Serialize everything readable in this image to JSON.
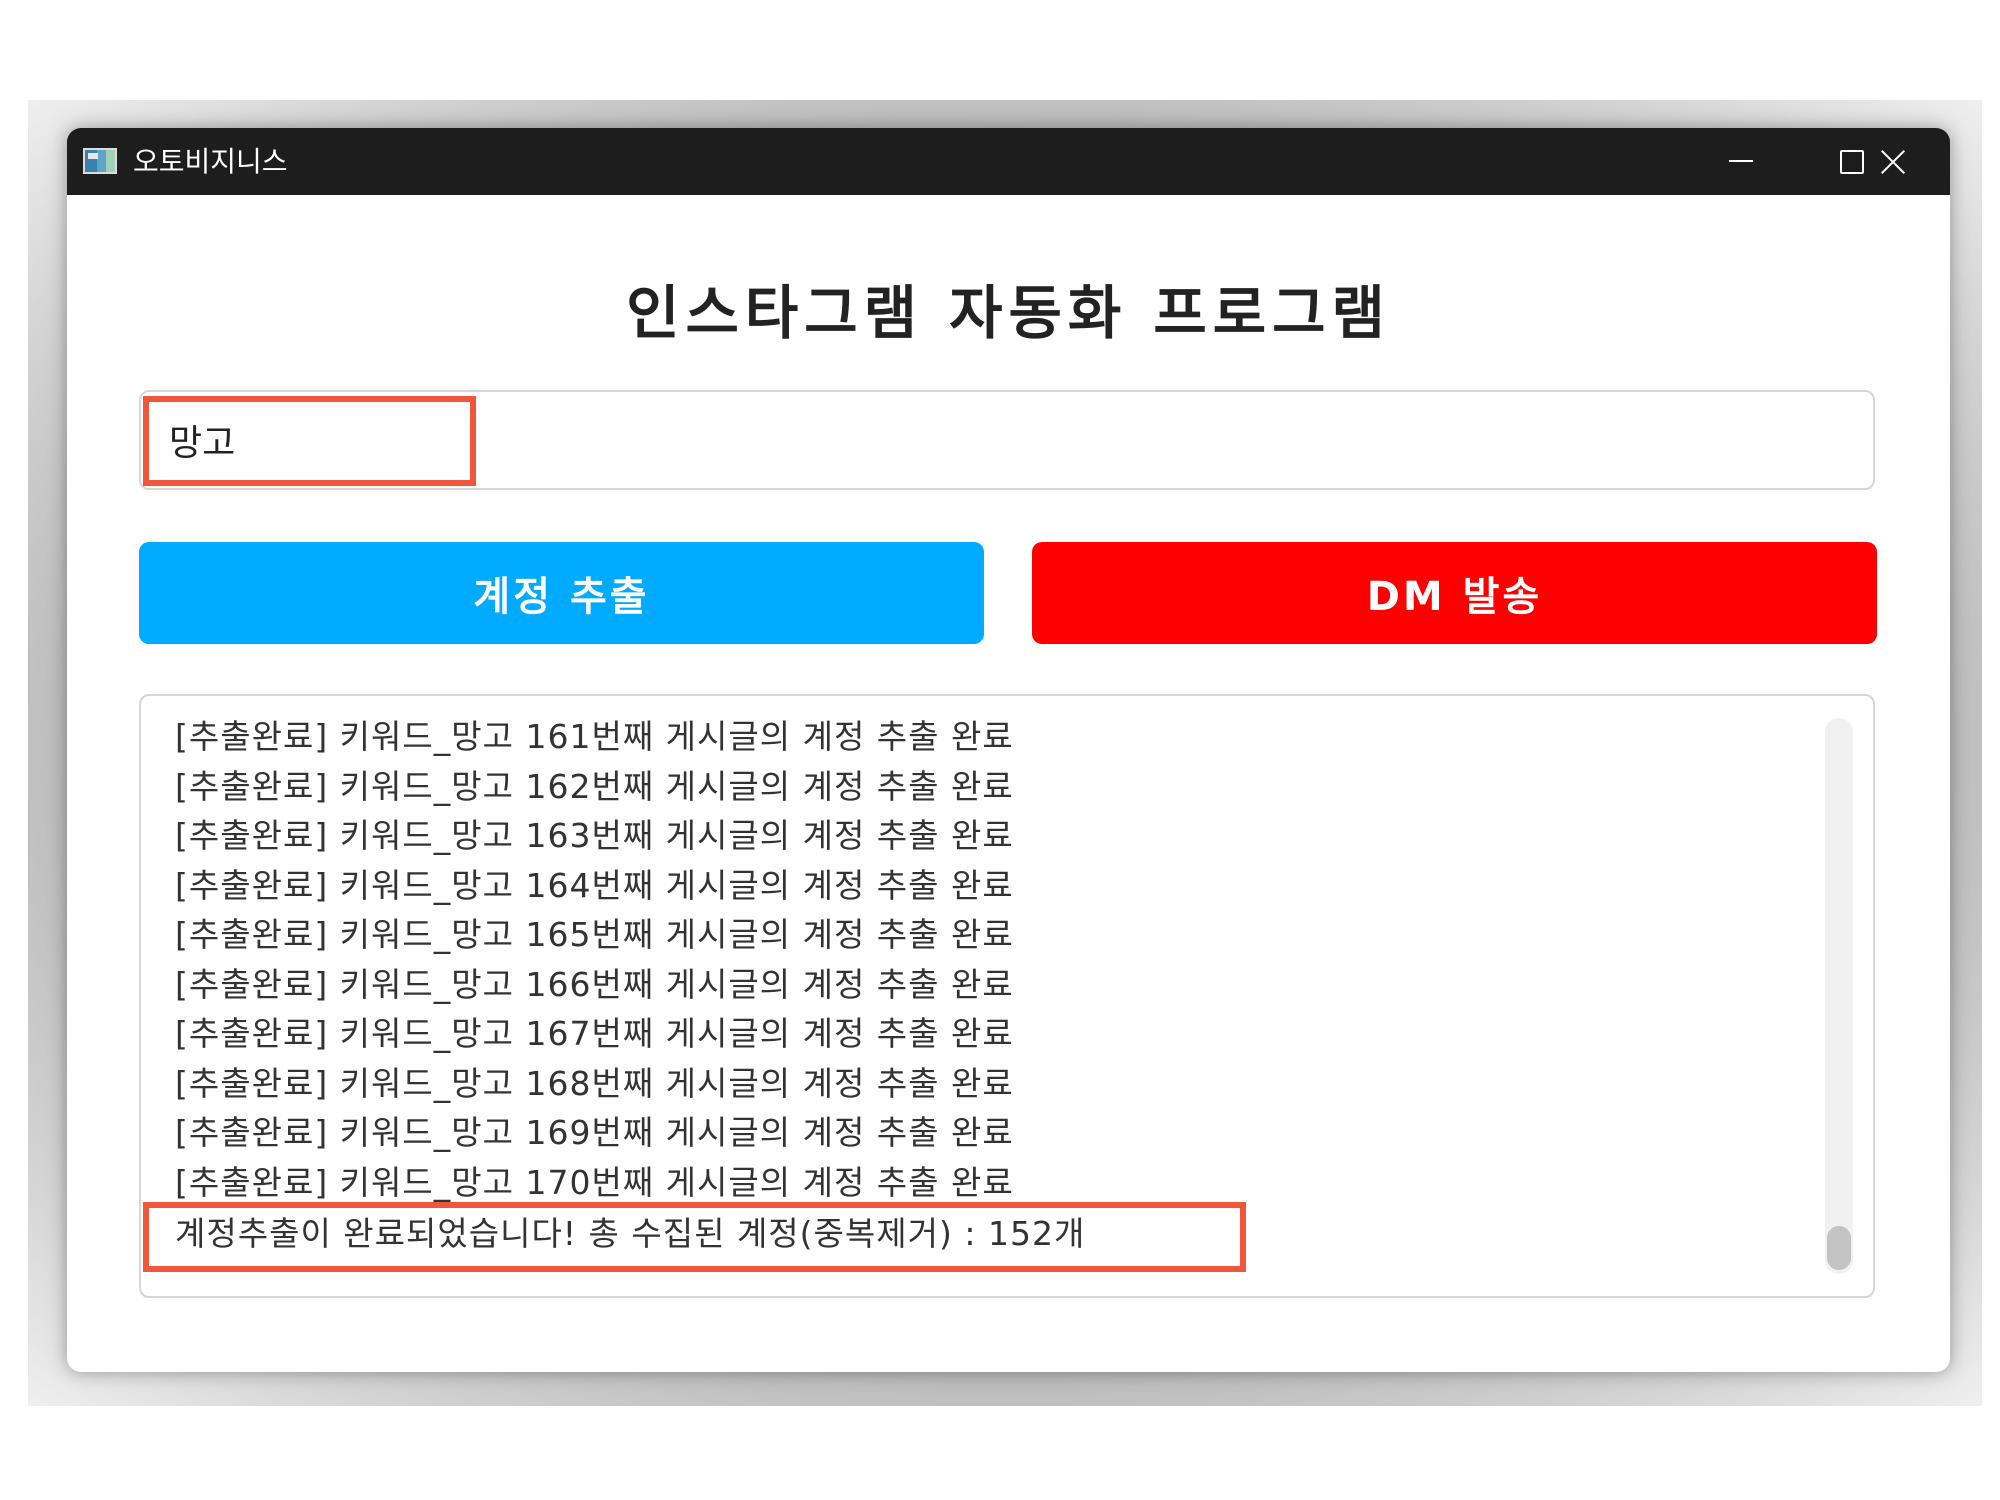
{
  "window": {
    "title": "오토비지니스"
  },
  "main": {
    "heading": "인스타그램 자동화 프로그램",
    "keyword_input": {
      "value": "망고"
    },
    "buttons": {
      "extract_label": "계정 추출",
      "dm_label": "DM 발송"
    },
    "log": {
      "lines": [
        "[추출완료] 키워드_망고 161번째 게시글의 계정 추출 완료",
        "[추출완료] 키워드_망고 162번째 게시글의 계정 추출 완료",
        "[추출완료] 키워드_망고 163번째 게시글의 계정 추출 완료",
        "[추출완료] 키워드_망고 164번째 게시글의 계정 추출 완료",
        "[추출완료] 키워드_망고 165번째 게시글의 계정 추출 완료",
        "[추출완료] 키워드_망고 166번째 게시글의 계정 추출 완료",
        "[추출완료] 키워드_망고 167번째 게시글의 계정 추출 완료",
        "[추출완료] 키워드_망고 168번째 게시글의 계정 추출 완료",
        "[추출완료] 키워드_망고 169번째 게시글의 계정 추출 완료",
        "[추출완료] 키워드_망고 170번째 게시글의 계정 추출 완료"
      ],
      "final_message": "계정추출이 완료되었습니다! 총 수집된 계정(중복제거) : 152개"
    }
  },
  "colors": {
    "extract_button": "#00aaff",
    "dm_button": "#ff0000",
    "highlight": "#f0563a",
    "titlebar": "#1d1d1d"
  }
}
